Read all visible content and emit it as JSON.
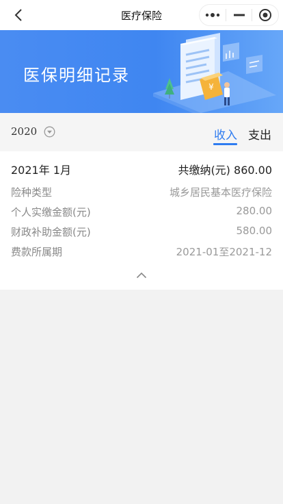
{
  "nav": {
    "title": "医疗保险",
    "back_icon": "chevron-left-icon",
    "more_icon": "more-dots-icon",
    "minimize_icon": "minus-icon",
    "close_icon": "target-circle-icon"
  },
  "banner": {
    "title": "医保明细记录",
    "illustration": "document-coin-person-illustration"
  },
  "filter": {
    "year": "2020",
    "year_icon": "chevron-down-circle-icon",
    "tabs": [
      {
        "label": "收入",
        "active": true
      },
      {
        "label": "支出",
        "active": false
      }
    ]
  },
  "record": {
    "date": "2021年 1月",
    "total": "共缴纳(元) 860.00",
    "rows": [
      {
        "label": "险种类型",
        "value": "城乡居民基本医疗保险"
      },
      {
        "label": "个人实缴金额(元)",
        "value": "280.00"
      },
      {
        "label": "财政补助金额(元)",
        "value": "580.00"
      },
      {
        "label": "费款所属期",
        "value": "2021-01至2021-12"
      }
    ],
    "collapse_icon": "chevron-up-icon"
  },
  "colors": {
    "accent": "#2f7cf0",
    "banner_start": "#4a8cf2",
    "banner_end": "#67a7f8",
    "background": "#f2f2f2"
  }
}
